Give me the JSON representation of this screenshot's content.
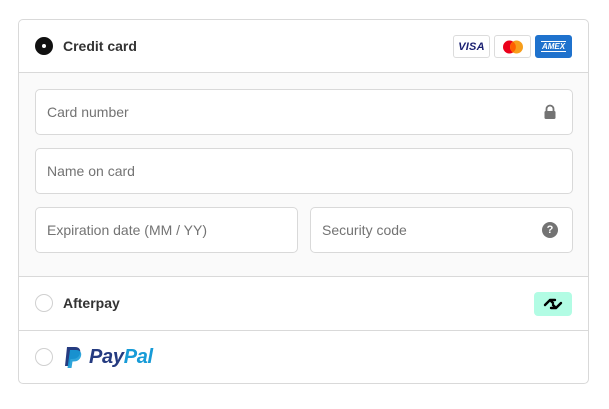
{
  "payment_options": {
    "credit_card": {
      "label": "Credit card",
      "selected": true,
      "card_brands": [
        "visa-logo",
        "mastercard-logo",
        "amex-logo"
      ],
      "visa_text": "VISA",
      "amex_text": "AMEX"
    },
    "afterpay": {
      "label": "Afterpay",
      "selected": false,
      "badge_color": "#b2fce4"
    },
    "paypal": {
      "logo_text_dark": "Pay",
      "logo_text_light": "Pal",
      "selected": false,
      "brand_dark": "#253b80",
      "brand_light": "#179bd7"
    }
  },
  "card_form": {
    "card_number": {
      "placeholder": "Card number",
      "value": "",
      "icon": "lock-icon"
    },
    "name_on_card": {
      "placeholder": "Name on card",
      "value": ""
    },
    "expiration": {
      "placeholder": "Expiration date (MM / YY)",
      "value": ""
    },
    "security_code": {
      "placeholder": "Security code",
      "value": "",
      "icon": "help-icon",
      "icon_glyph": "?"
    }
  },
  "colors": {
    "border": "#d9d9d9",
    "form_background": "#fafafa",
    "radio_selected": "#111111",
    "placeholder": "#737373"
  }
}
